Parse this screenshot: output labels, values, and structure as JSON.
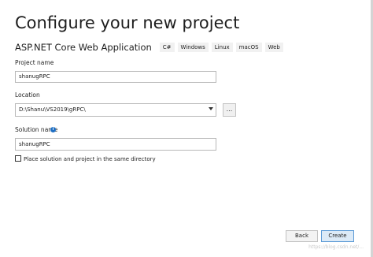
{
  "header": {
    "title": "Configure your new project",
    "template_name": "ASP.NET Core Web Application",
    "tags": [
      "C#",
      "Windows",
      "Linux",
      "macOS",
      "Web"
    ]
  },
  "form": {
    "project_name_label": "Project name",
    "project_name_value": "shanugRPC",
    "location_label": "Location",
    "location_value": "D:\\Shanu\\VS2019\\gRPC\\",
    "browse_label": "...",
    "solution_name_label": "Solution name",
    "solution_name_value": "shanugRPC",
    "info_icon_glyph": "i",
    "same_directory_label": "Place solution and project in the same directory",
    "same_directory_checked": false
  },
  "footer": {
    "back_label": "Back",
    "create_label": "Create"
  },
  "watermark": "https://blog.csdn.net/...",
  "colors": {
    "accent": "#1e6fc4",
    "primary_button_bg": "#dceaf7",
    "primary_button_border": "#5b9ad6"
  }
}
